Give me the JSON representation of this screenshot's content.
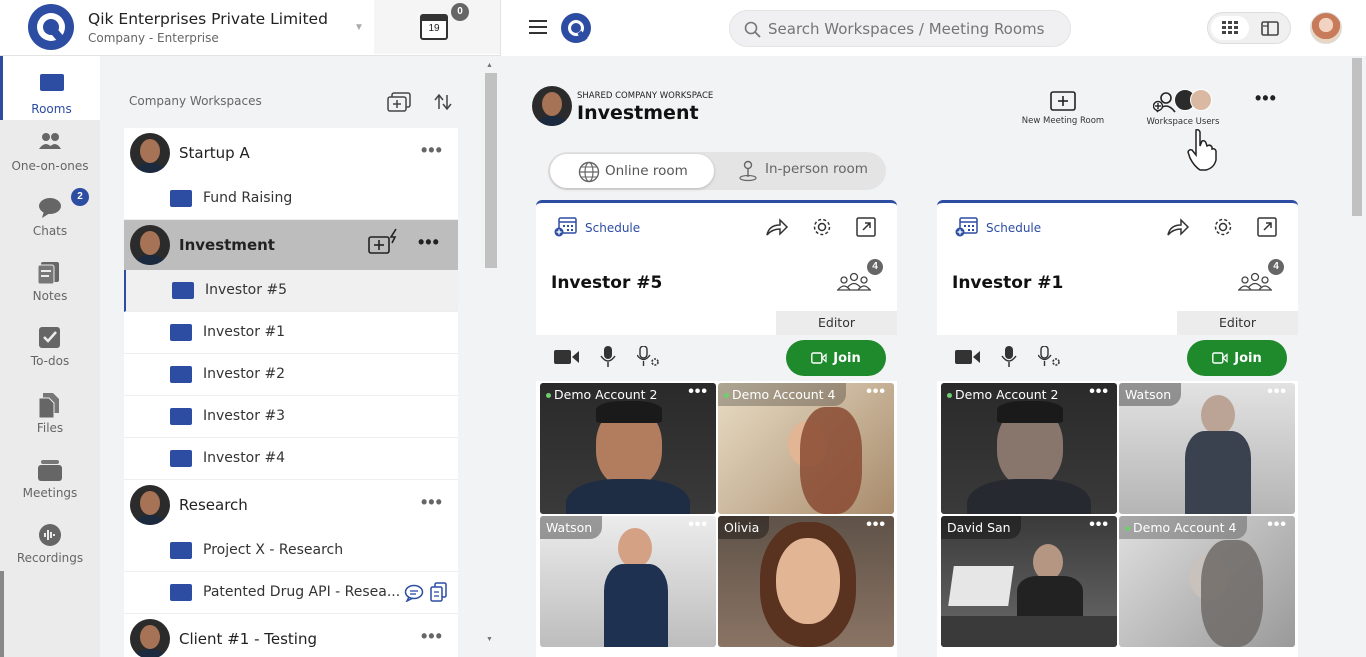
{
  "company": {
    "name": "Qik Enterprises Private Limited",
    "subtitle": "Company - Enterprise",
    "calendar_day": "19",
    "notification_count": "0"
  },
  "search": {
    "placeholder": "Search Workspaces / Meeting Rooms"
  },
  "rail": {
    "items": [
      {
        "label": "Rooms",
        "icon": "rooms-icon"
      },
      {
        "label": "One-on-ones",
        "icon": "people-icon"
      },
      {
        "label": "Chats",
        "icon": "chat-icon",
        "badge": "2"
      },
      {
        "label": "Notes",
        "icon": "notes-icon"
      },
      {
        "label": "To-dos",
        "icon": "todo-icon"
      },
      {
        "label": "Files",
        "icon": "files-icon"
      },
      {
        "label": "Meetings",
        "icon": "meetings-icon"
      },
      {
        "label": "Recordings",
        "icon": "recordings-icon"
      }
    ]
  },
  "workspaces": {
    "header": "Company Workspaces",
    "startup": {
      "name": "Startup A",
      "rooms": [
        "Fund Raising"
      ]
    },
    "investment": {
      "name": "Investment",
      "rooms": [
        "Investor #5",
        "Investor #1",
        "Investor #2",
        "Investor #3",
        "Investor #4"
      ]
    },
    "research": {
      "name": "Research",
      "rooms": [
        "Project X - Research",
        "Patented Drug API - Resea..."
      ]
    },
    "client": {
      "name": "Client #1 - Testing"
    }
  },
  "main": {
    "workspace_kicker": "SHARED COMPANY WORKSPACE",
    "workspace_title": "Investment",
    "new_room_label": "New Meeting Room",
    "workspace_users_label": "Workspace Users",
    "toggle": {
      "online": "Online room",
      "inperson": "In-person room"
    },
    "rooms": [
      {
        "schedule": "Schedule",
        "title": "Investor #5",
        "participants": "4",
        "editor": "Editor",
        "join": "Join",
        "tiles": [
          {
            "name": "Demo Account 2",
            "online": true
          },
          {
            "name": "Demo Account 4",
            "online": true
          },
          {
            "name": "Watson",
            "online": false
          },
          {
            "name": "Olivia",
            "online": false
          }
        ]
      },
      {
        "schedule": "Schedule",
        "title": "Investor #1",
        "participants": "4",
        "editor": "Editor",
        "join": "Join",
        "tiles": [
          {
            "name": "Demo Account 2",
            "online": true
          },
          {
            "name": "Watson",
            "online": false
          },
          {
            "name": "David San",
            "online": false
          },
          {
            "name": "Demo Account 4",
            "online": true
          }
        ]
      }
    ]
  },
  "colors": {
    "brand": "#2d4da3",
    "join": "#1e8a2c"
  }
}
